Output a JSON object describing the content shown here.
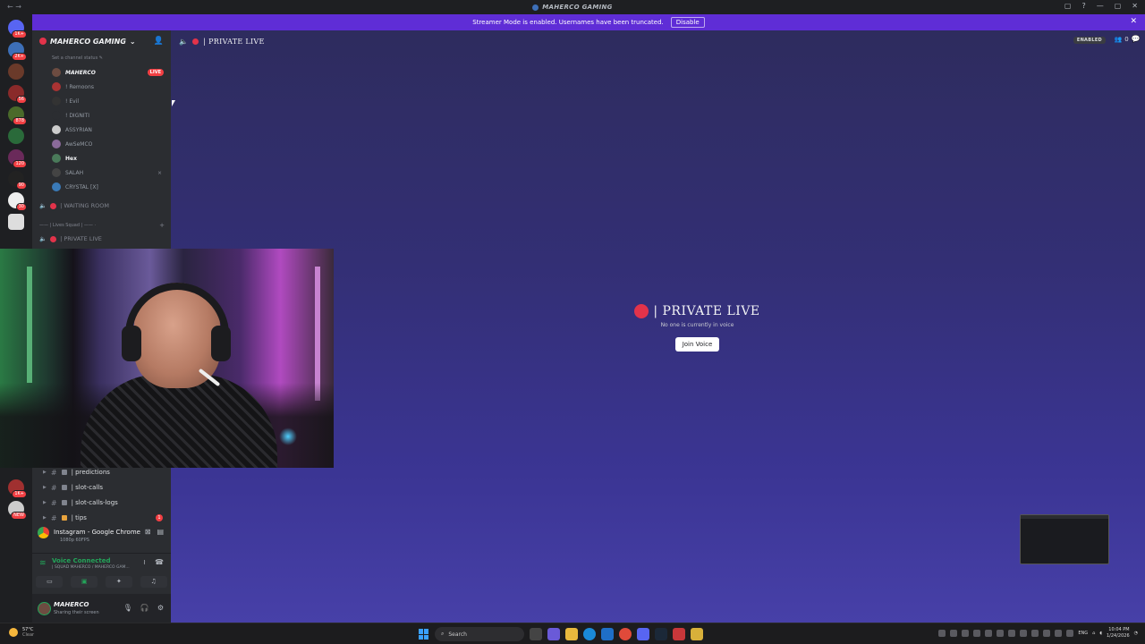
{
  "window": {
    "title": "MAHERCO GAMING",
    "nav_glyph": "← →",
    "controls": [
      "▢",
      "?",
      "—",
      "▢",
      "✕"
    ]
  },
  "guild_bar": {
    "guilds": [
      {
        "name": "discord-home-icon",
        "badge": "1K+"
      },
      {
        "name": "guild-1",
        "badge": "2K+"
      },
      {
        "name": "guild-2",
        "badge": ""
      },
      {
        "name": "guild-3",
        "badge": "56"
      },
      {
        "name": "guild-4",
        "badge": "878"
      },
      {
        "name": "guild-5",
        "badge": ""
      },
      {
        "name": "guild-6",
        "badge": "120"
      },
      {
        "name": "guild-7",
        "badge": "90"
      },
      {
        "name": "guild-8",
        "badge": "30"
      },
      {
        "name": "guild-9",
        "badge": ""
      },
      {
        "name": "guild-10",
        "badge": "1K+"
      },
      {
        "name": "guild-11",
        "badge": "NEW"
      }
    ]
  },
  "banner": {
    "text": "Streamer Mode is enabled. Usernames have been truncated.",
    "button": "Disable",
    "close": "✕"
  },
  "sidebar": {
    "server_name": "MAHERCO GAMING",
    "chevron": "⌄",
    "invite_icon": "👤",
    "channel_status": "Set a channel status ✎",
    "voice_users": [
      {
        "name": "MAHERCO",
        "live": "LIVE"
      },
      {
        "name": "! Remoons",
        "live": ""
      },
      {
        "name": "! Evil",
        "live": ""
      },
      {
        "name": "! DIGNITI",
        "live": ""
      },
      {
        "name": "ASSYRIAN",
        "live": ""
      },
      {
        "name": "AwSeMCO",
        "live": ""
      },
      {
        "name": "Hex",
        "live": ""
      },
      {
        "name": "SALAH",
        "live": ""
      },
      {
        "name": "CRYSTAL [X]",
        "live": ""
      }
    ],
    "waiting_room": "| WAITING ROOM",
    "category": "—— | Lives Squad | —— ·",
    "category_plus": "+",
    "private_live": "| PRIVATE LIVE",
    "text_channels": [
      {
        "label": "| predictions",
        "unread": ""
      },
      {
        "label": "| slot-calls",
        "unread": ""
      },
      {
        "label": "| slot-calls-logs",
        "unread": ""
      },
      {
        "label": "| tips",
        "unread": "1"
      }
    ]
  },
  "stream_panel": {
    "title": "Instagram - Google Chrome",
    "sub": "1080p 60FPS"
  },
  "voice_panel": {
    "status": "Voice Connected",
    "sub": "| SQUAD MAHERCO / MAHERCO GAM..."
  },
  "user_panel": {
    "name": "MAHERCO",
    "status": "Sharing their screen"
  },
  "main": {
    "channel": "| PRIVATE LIVE",
    "enabled_badge": "ENABLED",
    "people_count": "0",
    "center_title": "| PRIVATE LIVE",
    "center_sub": "No one is currently in voice",
    "join_button": "Join Voice"
  },
  "taskbar": {
    "temp": "57°C",
    "condition": "Clear",
    "search_placeholder": "Search",
    "lang": "ENG",
    "time": "10:04 PM",
    "date": "1/24/2026"
  },
  "colors": {
    "accent": "#5f2dd6",
    "live": "#f23f43",
    "voice_green": "#23a55a",
    "main_bg": "#332f75"
  }
}
